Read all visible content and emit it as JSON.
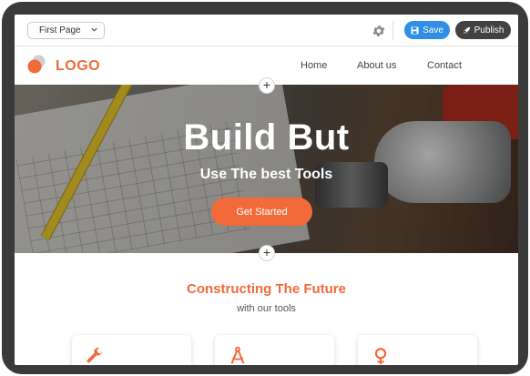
{
  "toolbar": {
    "page_select_value": "First Page",
    "save_label": "Save",
    "publish_label": "Publish"
  },
  "navbar": {
    "logo_text": "LOGO",
    "links": [
      "Home",
      "About us",
      "Contact"
    ]
  },
  "hero": {
    "title": "Build But",
    "subtitle": "Use The best Tools",
    "cta_label": "Get Started"
  },
  "add_section": {
    "label": "+"
  },
  "section": {
    "title": "Constructing The Future",
    "subtitle": "with our  tools"
  },
  "cards": [
    {
      "icon": "wrench-icon"
    },
    {
      "icon": "compass-icon"
    },
    {
      "icon": "plumb-bob-icon"
    }
  ],
  "colors": {
    "accent": "#f26a3a",
    "save_button": "#2f8ee5",
    "publish_button": "#424242",
    "frame": "#3a3a3a"
  }
}
